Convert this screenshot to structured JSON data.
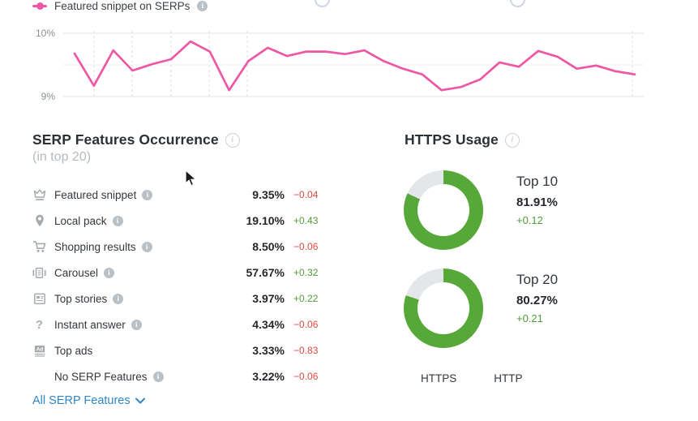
{
  "chart": {
    "legend_label": "Featured snippet on SERPs",
    "y_tick_top": "10%",
    "y_tick_bottom": "9%"
  },
  "chart_data": {
    "type": "line",
    "title": "Featured snippet on SERPs",
    "ylabel": "",
    "xlabel": "",
    "ylim": [
      9,
      10
    ],
    "y_gridlines": [
      10,
      9.5,
      9
    ],
    "grid": true,
    "legend_position": "top-left",
    "series": [
      {
        "name": "Featured snippet on SERPs",
        "color": "#ee57a3",
        "values": [
          9.68,
          9.17,
          9.73,
          9.41,
          9.51,
          9.59,
          9.87,
          9.71,
          9.1,
          9.56,
          9.77,
          9.64,
          9.71,
          9.71,
          9.67,
          9.73,
          9.56,
          9.44,
          9.35,
          9.1,
          9.15,
          9.27,
          9.54,
          9.47,
          9.72,
          9.63,
          9.44,
          9.49,
          9.4,
          9.35
        ]
      }
    ]
  },
  "serp_features": {
    "title": "SERP Features Occurrence",
    "subtitle": "(in top 20)",
    "link_label": "All SERP Features",
    "rows": [
      {
        "icon": "crown-icon",
        "label": "Featured snippet",
        "info": true,
        "value": "9.35%",
        "change": "−0.04",
        "dir": "down"
      },
      {
        "icon": "pin-icon",
        "label": "Local pack",
        "info": true,
        "value": "19.10%",
        "change": "+0.43",
        "dir": "up"
      },
      {
        "icon": "cart-icon",
        "label": "Shopping results",
        "info": true,
        "value": "8.50%",
        "change": "−0.06",
        "dir": "down"
      },
      {
        "icon": "carousel-icon",
        "label": "Carousel",
        "info": true,
        "value": "57.67%",
        "change": "+0.32",
        "dir": "up"
      },
      {
        "icon": "news-icon",
        "label": "Top stories",
        "info": true,
        "value": "3.97%",
        "change": "+0.22",
        "dir": "up"
      },
      {
        "icon": "question-icon",
        "label": "Instant answer",
        "info": true,
        "value": "4.34%",
        "change": "−0.06",
        "dir": "down"
      },
      {
        "icon": "ad-icon",
        "label": "Top ads",
        "info": false,
        "value": "3.33%",
        "change": "−0.83",
        "dir": "down"
      },
      {
        "icon": null,
        "label": "No SERP Features",
        "info": true,
        "value": "3.22%",
        "change": "−0.06",
        "dir": "down"
      }
    ]
  },
  "https_usage": {
    "title": "HTTPS Usage",
    "donuts": [
      {
        "label": "Top 10",
        "value": "81.91%",
        "percent": 81.91,
        "change": "+0.12"
      },
      {
        "label": "Top 20",
        "value": "80.27%",
        "percent": 80.27,
        "change": "+0.21"
      }
    ],
    "legend": [
      {
        "label": "HTTPS",
        "color": "#56a839"
      },
      {
        "label": "HTTP",
        "color": "#e3e7e9"
      }
    ]
  },
  "colors": {
    "accent_pink": "#ee57a3",
    "https_green": "#56a839",
    "http_gray": "#e3e7e9",
    "negative_red": "#e2483d",
    "positive_green": "#4e9d35",
    "link_blue": "#2f86c6"
  }
}
